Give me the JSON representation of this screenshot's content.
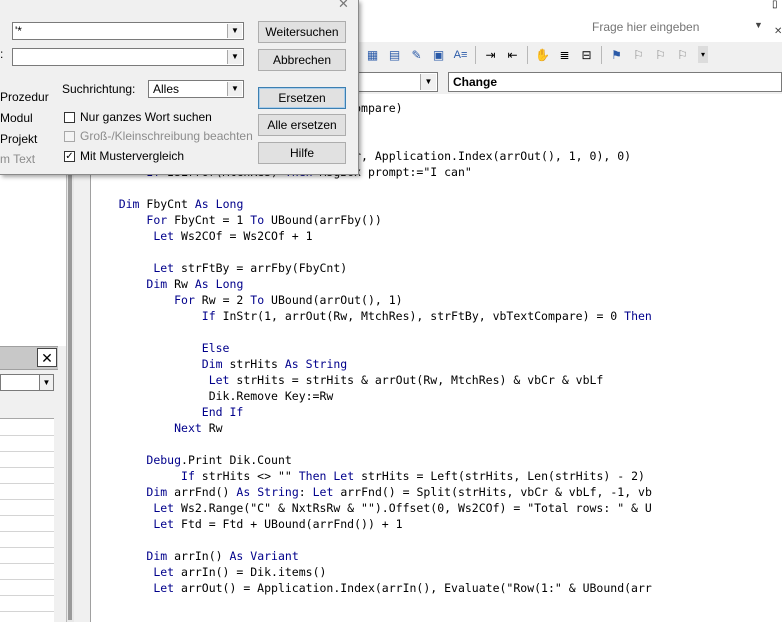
{
  "help": {
    "placeholder": "Frage hier eingeben"
  },
  "find_dialog": {
    "search_value": "'*",
    "replace_value": "",
    "scope_options": [
      "Prozedur",
      "Modul",
      "Projekt",
      "m Text"
    ],
    "direction_label": "Suchrichtung:",
    "direction_value": "Alles",
    "whole_word_label": "Nur ganzes Wort suchen",
    "match_case_label": "Groß-/Kleinschreibung beachten",
    "pattern_label": "Mit Mustervergleich",
    "pattern_checked": true,
    "buttons": {
      "find_next": "Weitersuchen",
      "cancel": "Abbrechen",
      "replace": "Ersetzen",
      "replace_all": "Alle ersetzen",
      "help": "Hilfe"
    }
  },
  "code_window": {
    "object_value": "",
    "procedure_value": "Change"
  },
  "code_lines": [
    "                 r, \",\", -1, vbBinaryCompare)",
    "",
    "",
    "    Let MtchRes = Application.Match(Hdr, Application.Index(arrOut(), 1, 0), 0)",
    "        If IsError(MtchRes) Then MsgBox prompt:=\"I can\"",
    "",
    "    Dim FbyCnt As Long",
    "        For FbyCnt = 1 To UBound(arrFby())",
    "         Let Ws2COf = Ws2COf + 1",
    "",
    "         Let strFtBy = arrFby(FbyCnt)",
    "        Dim Rw As Long",
    "            For Rw = 2 To UBound(arrOut(), 1)",
    "                If InStr(1, arrOut(Rw, MtchRes), strFtBy, vbTextCompare) = 0 Then",
    "",
    "                Else",
    "                Dim strHits As String",
    "                 Let strHits = strHits & arrOut(Rw, MtchRes) & vbCr & vbLf",
    "                 Dik.Remove Key:=Rw",
    "                End If",
    "            Next Rw",
    "",
    "        Debug.Print Dik.Count",
    "             If strHits <> \"\" Then Let strHits = Left(strHits, Len(strHits) - 2)",
    "        Dim arrFnd() As String: Let arrFnd() = Split(strHits, vbCr & vbLf, -1, vb",
    "         Let Ws2.Range(\"C\" & NxtRsRw & \"\").Offset(0, Ws2COf) = \"Total rows: \" & U",
    "         Let Ftd = Ftd + UBound(arrFnd()) + 1",
    "",
    "        Dim arrIn() As Variant",
    "         Let arrIn() = Dik.items()",
    "         Let arrOut() = Application.Index(arrIn(), Evaluate(\"Row(1:\" & UBound(arr"
  ],
  "colors": {
    "keyword": "#00008b",
    "background": "#f0f0f0"
  }
}
